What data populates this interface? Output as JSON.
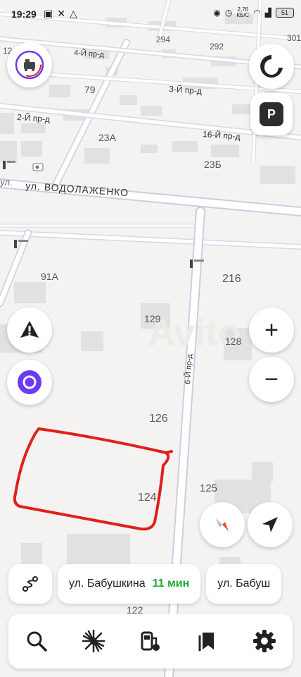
{
  "status_bar": {
    "time": "19:29",
    "net_speed_value": "2,76",
    "net_speed_unit": "КБ/С",
    "battery": "51"
  },
  "map": {
    "streets": {
      "main": "ул. ВОДОЛАЖЕНКО",
      "main_prefix": "ул.",
      "lane_2": "2-Й пр-д",
      "lane_3": "3-Й пр-д",
      "lane_4": "4-Й пр-д",
      "lane_16": "16-Й пр-д",
      "lane_6": "6-Й пр-д"
    },
    "house_numbers": {
      "h294": "294",
      "h292": "292",
      "h301": "301",
      "h12": "12",
      "h79": "79",
      "h23a": "23А",
      "h23b": "23Б",
      "h91a": "91А",
      "h216": "216",
      "h129": "129",
      "h128": "128",
      "h126": "126",
      "h125": "125",
      "h124": "124",
      "h122": "122"
    },
    "watermark": "Avito"
  },
  "route_bar": {
    "destination_1": "ул. Бабушкина",
    "eta_1": "11 мин",
    "destination_2": "ул. Бабуш"
  },
  "colors": {
    "accent_alice": "#6c3bf5",
    "eta_green": "#1faa37",
    "drawing_red": "#e0201c",
    "compass_red": "#e74c3c"
  }
}
